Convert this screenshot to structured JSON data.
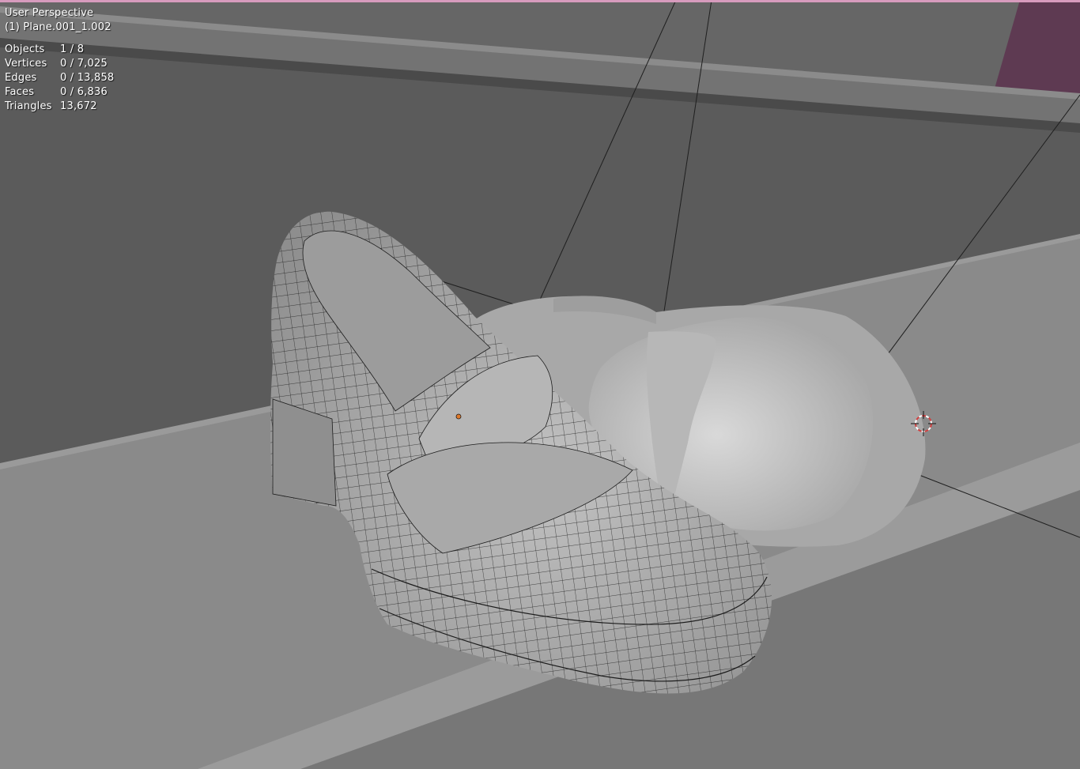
{
  "viewport": {
    "view_name": "User Perspective",
    "object_name": "(1) Plane.001_1.002",
    "stats": [
      {
        "label": "Objects",
        "value": "1 / 8"
      },
      {
        "label": "Vertices",
        "value": "0 / 7,025"
      },
      {
        "label": "Edges",
        "value": "0 / 13,858"
      },
      {
        "label": "Faces",
        "value": "0 / 6,836"
      },
      {
        "label": "Triangles",
        "value": "13,672"
      }
    ]
  },
  "colors": {
    "background": "#5c5c5c",
    "floor": "#8a8a8a",
    "mesh": "#b4b4b4",
    "wireframe": "#1c1c1c",
    "accent_top": "#d79bbd",
    "corner_magenta": "#5e3a52",
    "origin_dot": "#e07a2c",
    "cursor_ring": "#d04040"
  },
  "icons": [
    "3d-cursor-icon",
    "origin-point-icon"
  ]
}
